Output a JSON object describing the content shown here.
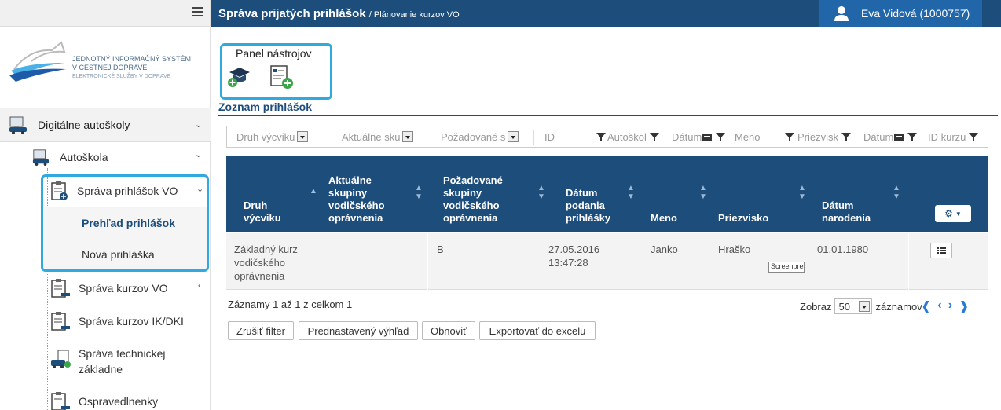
{
  "header": {
    "title": "Správa prijatých prihlášok",
    "breadcrumb": "/ Plánovanie kurzov VO",
    "user": "Eva Vidová (1000757)"
  },
  "logo": {
    "line1": "JEDNOTNÝ INFORMAČNÝ SYSTÉM",
    "line2": "V CESTNEJ DOPRAVE",
    "line3": "ELEKTRONICKÉ SLUŽBY V DOPRAVE"
  },
  "sidebar": {
    "main": "Digitálne autoškoly",
    "autoskola": "Autoškola",
    "sprava_prihlasok": "Správa prihlášok VO",
    "prehlad": "Prehľad prihlášok",
    "nova": "Nová prihláška",
    "sprava_kurzov": "Správa kurzov VO",
    "sprava_kurzov_ik": "Správa kurzov IK/DKI",
    "sprava_tech_1": "Správa technickej",
    "sprava_tech_2": "základne",
    "ospravedlnenky": "Ospravedlnenky"
  },
  "toolbar": {
    "panel_title": "Panel nástrojov"
  },
  "list": {
    "title": "Zoznam prihlášok"
  },
  "filters": {
    "druh": "Druh výcviku",
    "aktualne": "Aktuálne sku",
    "pozadovane": "Požadované s",
    "id": "ID",
    "autoskola": "Autoškol",
    "datum1": "Dátum",
    "meno": "Meno",
    "priezvisko": "Priezvisk",
    "datum2": "Dátum",
    "id_kurzu": "ID kurzu"
  },
  "table": {
    "col_druh_1": "Druh",
    "col_druh_2": "výcviku",
    "col_akt_1": "Aktuálne",
    "col_akt_2": "skupiny",
    "col_akt_3": "vodičského",
    "col_akt_4": "oprávnenia",
    "col_poz_1": "Požadované",
    "col_poz_2": "skupiny",
    "col_poz_3": "vodičského",
    "col_poz_4": "oprávnenia",
    "col_dat_1": "Dátum",
    "col_dat_2": "podania",
    "col_dat_3": "prihlášky",
    "col_meno": "Meno",
    "col_priezvisko": "Priezvisko",
    "col_nar_1": "Dátum",
    "col_nar_2": "narodenia",
    "row": {
      "druh_1": "Základný kurz",
      "druh_2": "vodičského",
      "druh_3": "oprávnenia",
      "aktualne": "",
      "pozadovane": "B",
      "datum_1": "27.05.2016",
      "datum_2": "13:47:28",
      "meno": "Janko",
      "priezvisko": "Hraško",
      "narodenie": "01.01.1980"
    },
    "tooltip": "Screenpresso"
  },
  "footer": {
    "summary": "Záznamy 1 až 1 z celkom 1",
    "zobraz": "Zobraz",
    "page_size": "50",
    "zaznamov": "záznamov",
    "btn_zrusit": "Zrušiť filter",
    "btn_prednastaveny": "Prednastavený výhľad",
    "btn_obnovit": "Obnoviť",
    "btn_export": "Exportovať do excelu"
  },
  "colors": {
    "header_bg": "#1d4d7b",
    "user_bg": "#2266aa",
    "highlight": "#2fa9e0"
  }
}
